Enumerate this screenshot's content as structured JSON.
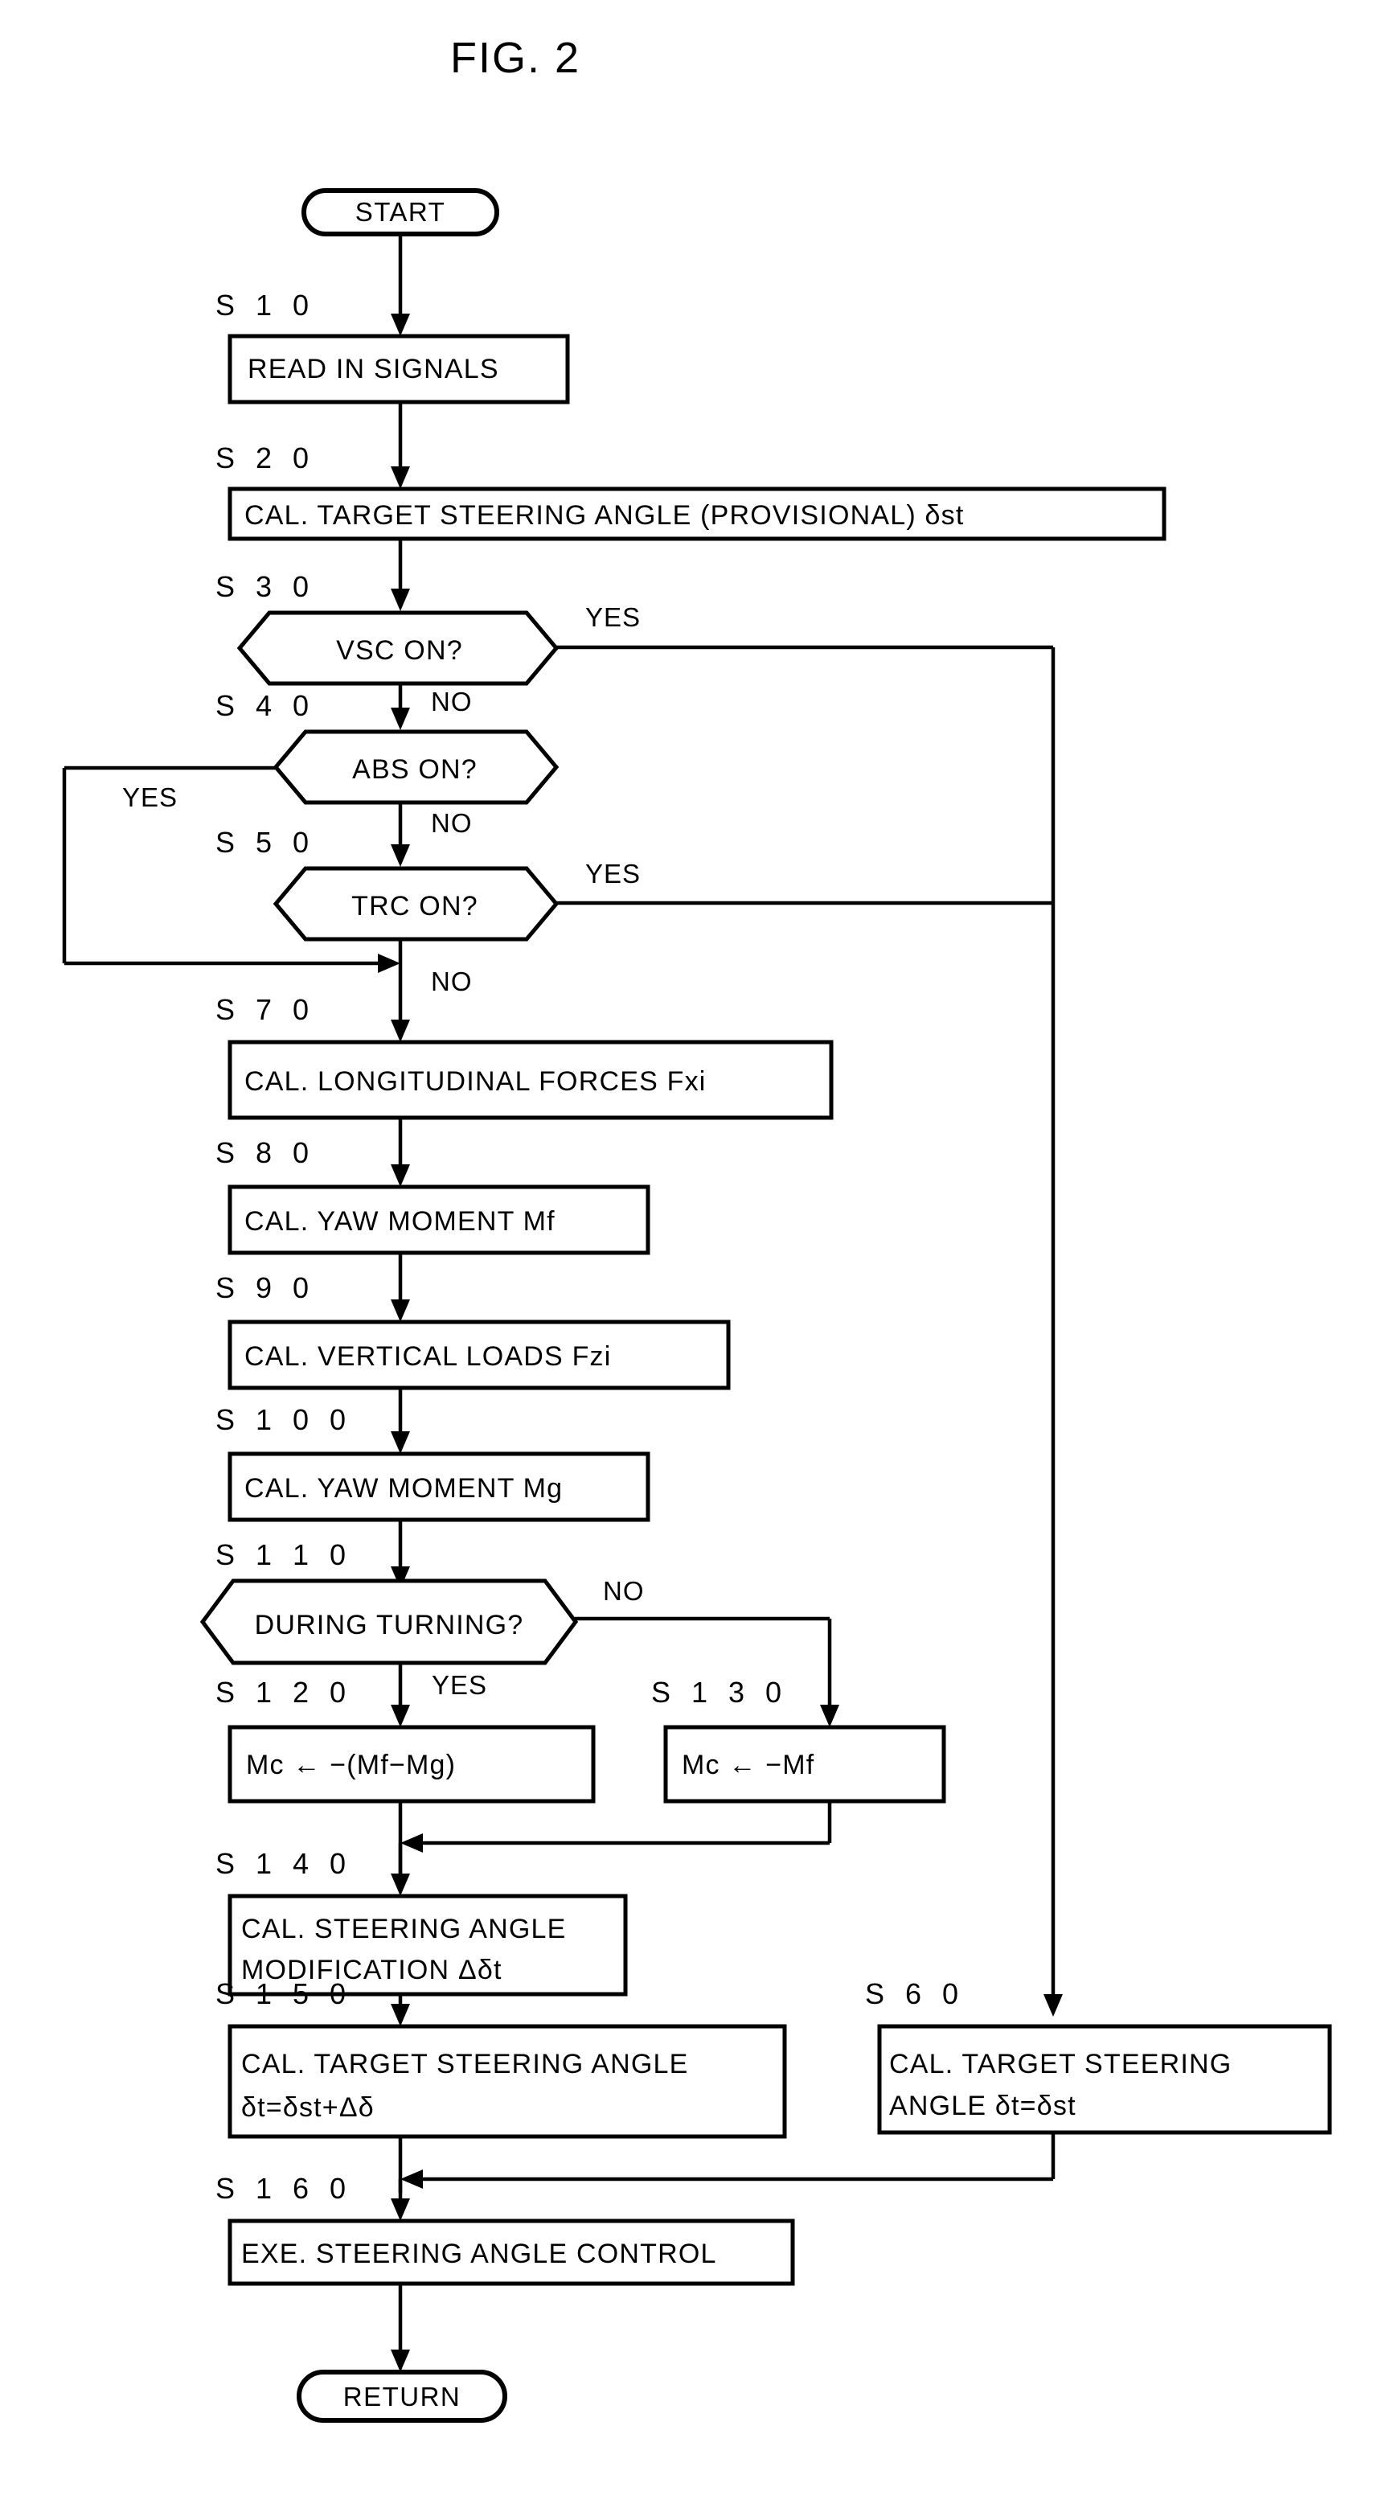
{
  "figure": {
    "title": "FIG. 2",
    "type": "patent-flowchart"
  },
  "terminators": {
    "start": "START",
    "end": "RETURN"
  },
  "steps": [
    {
      "id": "S10",
      "label": "S 1 0",
      "text_line1": "READ IN SIGNALS",
      "text_line2": "",
      "shape": "process"
    },
    {
      "id": "S20",
      "label": "S 2 0",
      "text_line1": "CAL. TARGET STEERING ANGLE (PROVISIONAL) δst",
      "text_line2": "",
      "shape": "process"
    },
    {
      "id": "S30",
      "label": "S 3 0",
      "text_line1": "VSC ON?",
      "text_line2": "",
      "shape": "decision"
    },
    {
      "id": "S40",
      "label": "S 4 0",
      "text_line1": "ABS ON?",
      "text_line2": "",
      "shape": "decision"
    },
    {
      "id": "S50",
      "label": "S 5 0",
      "text_line1": "TRC ON?",
      "text_line2": "",
      "shape": "decision"
    },
    {
      "id": "S70",
      "label": "S 7 0",
      "text_line1": "CAL. LONGITUDINAL FORCES Fxi",
      "text_line2": "",
      "shape": "process"
    },
    {
      "id": "S80",
      "label": "S 8 0",
      "text_line1": "CAL. YAW MOMENT Mf",
      "text_line2": "",
      "shape": "process"
    },
    {
      "id": "S90",
      "label": "S 9 0",
      "text_line1": "CAL. VERTICAL LOADS Fzi",
      "text_line2": "",
      "shape": "process"
    },
    {
      "id": "S100",
      "label": "S 1 0 0",
      "text_line1": "CAL. YAW MOMENT Mg",
      "text_line2": "",
      "shape": "process"
    },
    {
      "id": "S110",
      "label": "S 1 1 0",
      "text_line1": "DURING TURNING?",
      "text_line2": "",
      "shape": "decision"
    },
    {
      "id": "S120",
      "label": "S 1 2 0",
      "text_line1": "Mc ← −(Mf−Mg)",
      "text_line2": "",
      "shape": "process"
    },
    {
      "id": "S130",
      "label": "S 1 3 0",
      "text_line1": "Mc ← −Mf",
      "text_line2": "",
      "shape": "process"
    },
    {
      "id": "S140",
      "label": "S 1 4 0",
      "text_line1": "CAL. STEERING ANGLE",
      "text_line2": "MODIFICATION Δδt",
      "shape": "process"
    },
    {
      "id": "S150",
      "label": "S 1 5 0",
      "text_line1": "CAL. TARGET STEERING ANGLE",
      "text_line2": "δt=δst+Δδ",
      "shape": "process"
    },
    {
      "id": "S60",
      "label": "S 6 0",
      "text_line1": "CAL. TARGET STEERING",
      "text_line2": "ANGLE    δt=δst",
      "shape": "process"
    },
    {
      "id": "S160",
      "label": "S 1 6 0",
      "text_line1": "EXE. STEERING ANGLE CONTROL",
      "text_line2": "",
      "shape": "process"
    }
  ],
  "branch_labels": {
    "s30_yes": "YES",
    "s30_no": "NO",
    "s40_yes": "YES",
    "s40_no": "NO",
    "s50_yes": "YES",
    "s50_no": "NO",
    "s110_yes": "YES",
    "s110_no": "NO"
  },
  "colors": {
    "ink": "#000000",
    "paper": "#ffffff"
  }
}
